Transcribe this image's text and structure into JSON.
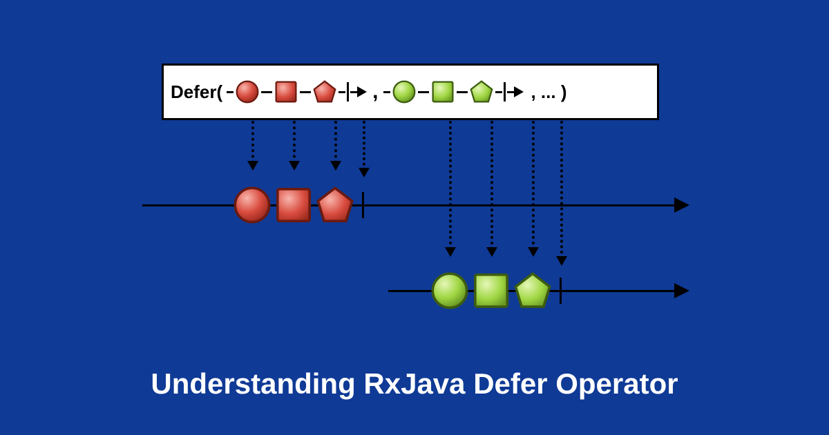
{
  "title": "Understanding RxJava Defer Operator",
  "defer_label": "Defer(",
  "comma": ",",
  "ellipsis": ", ... )",
  "colors": {
    "red_fill": "#d94c3f",
    "red_stroke": "#7a1d14",
    "green_fill": "#9fd642",
    "green_stroke": "#4a6b15",
    "bg": "#0f3a96"
  },
  "sequences": {
    "top_red": [
      "circle",
      "square",
      "pentagon"
    ],
    "top_green": [
      "circle",
      "square",
      "pentagon"
    ],
    "timeline1": [
      "circle",
      "square",
      "pentagon"
    ],
    "timeline2": [
      "circle",
      "square",
      "pentagon"
    ]
  }
}
